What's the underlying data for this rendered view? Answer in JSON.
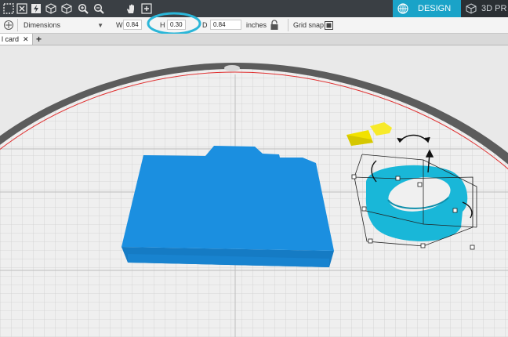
{
  "toolbar": {
    "tools": [
      "grid-icon",
      "close-icon",
      "bolt-icon",
      "cube-icon",
      "cube-outline-icon",
      "zoom-in-icon",
      "zoom-out-icon",
      "hand-pan-icon",
      "add-icon"
    ]
  },
  "tabs": {
    "design_label": "DESIGN",
    "print_label": "3D PR"
  },
  "options": {
    "dropdown_value": "Dimensions",
    "w_label": "W",
    "w_value": "0.84",
    "h_label": "H",
    "h_value": "0.30",
    "d_label": "D",
    "d_value": "0.84",
    "units": "inches",
    "grid_snap_label": "Grid snap"
  },
  "document": {
    "tab_label": "l card"
  },
  "colors": {
    "accent": "#1aa3c8",
    "highlight_circle": "#2bb6d8",
    "blue_object": "#1b8fe0",
    "ring_object": "#19b7d8",
    "yellow_object": "#f2e200",
    "platform_edge": "#5a5a5a",
    "boundary_line": "#e03030"
  }
}
